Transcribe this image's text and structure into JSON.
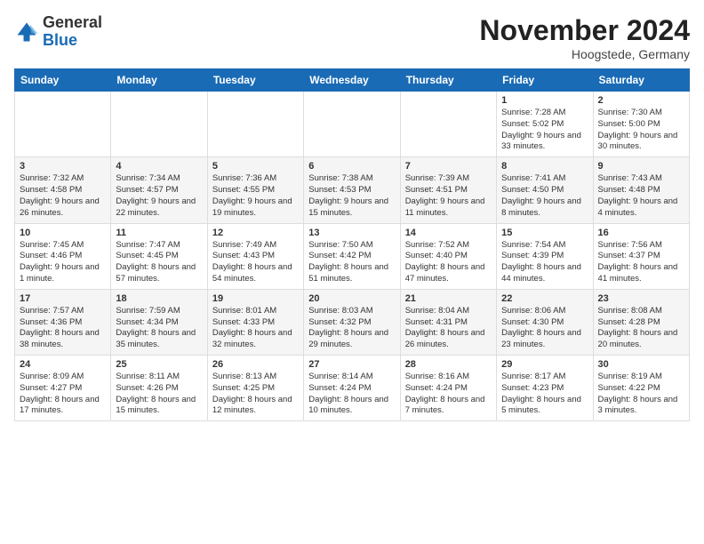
{
  "logo": {
    "general": "General",
    "blue": "Blue"
  },
  "header": {
    "month": "November 2024",
    "location": "Hoogstede, Germany"
  },
  "weekdays": [
    "Sunday",
    "Monday",
    "Tuesday",
    "Wednesday",
    "Thursday",
    "Friday",
    "Saturday"
  ],
  "weeks": [
    [
      {
        "day": "",
        "info": ""
      },
      {
        "day": "",
        "info": ""
      },
      {
        "day": "",
        "info": ""
      },
      {
        "day": "",
        "info": ""
      },
      {
        "day": "",
        "info": ""
      },
      {
        "day": "1",
        "info": "Sunrise: 7:28 AM\nSunset: 5:02 PM\nDaylight: 9 hours\nand 33 minutes."
      },
      {
        "day": "2",
        "info": "Sunrise: 7:30 AM\nSunset: 5:00 PM\nDaylight: 9 hours\nand 30 minutes."
      }
    ],
    [
      {
        "day": "3",
        "info": "Sunrise: 7:32 AM\nSunset: 4:58 PM\nDaylight: 9 hours\nand 26 minutes."
      },
      {
        "day": "4",
        "info": "Sunrise: 7:34 AM\nSunset: 4:57 PM\nDaylight: 9 hours\nand 22 minutes."
      },
      {
        "day": "5",
        "info": "Sunrise: 7:36 AM\nSunset: 4:55 PM\nDaylight: 9 hours\nand 19 minutes."
      },
      {
        "day": "6",
        "info": "Sunrise: 7:38 AM\nSunset: 4:53 PM\nDaylight: 9 hours\nand 15 minutes."
      },
      {
        "day": "7",
        "info": "Sunrise: 7:39 AM\nSunset: 4:51 PM\nDaylight: 9 hours\nand 11 minutes."
      },
      {
        "day": "8",
        "info": "Sunrise: 7:41 AM\nSunset: 4:50 PM\nDaylight: 9 hours\nand 8 minutes."
      },
      {
        "day": "9",
        "info": "Sunrise: 7:43 AM\nSunset: 4:48 PM\nDaylight: 9 hours\nand 4 minutes."
      }
    ],
    [
      {
        "day": "10",
        "info": "Sunrise: 7:45 AM\nSunset: 4:46 PM\nDaylight: 9 hours\nand 1 minute."
      },
      {
        "day": "11",
        "info": "Sunrise: 7:47 AM\nSunset: 4:45 PM\nDaylight: 8 hours\nand 57 minutes."
      },
      {
        "day": "12",
        "info": "Sunrise: 7:49 AM\nSunset: 4:43 PM\nDaylight: 8 hours\nand 54 minutes."
      },
      {
        "day": "13",
        "info": "Sunrise: 7:50 AM\nSunset: 4:42 PM\nDaylight: 8 hours\nand 51 minutes."
      },
      {
        "day": "14",
        "info": "Sunrise: 7:52 AM\nSunset: 4:40 PM\nDaylight: 8 hours\nand 47 minutes."
      },
      {
        "day": "15",
        "info": "Sunrise: 7:54 AM\nSunset: 4:39 PM\nDaylight: 8 hours\nand 44 minutes."
      },
      {
        "day": "16",
        "info": "Sunrise: 7:56 AM\nSunset: 4:37 PM\nDaylight: 8 hours\nand 41 minutes."
      }
    ],
    [
      {
        "day": "17",
        "info": "Sunrise: 7:57 AM\nSunset: 4:36 PM\nDaylight: 8 hours\nand 38 minutes."
      },
      {
        "day": "18",
        "info": "Sunrise: 7:59 AM\nSunset: 4:34 PM\nDaylight: 8 hours\nand 35 minutes."
      },
      {
        "day": "19",
        "info": "Sunrise: 8:01 AM\nSunset: 4:33 PM\nDaylight: 8 hours\nand 32 minutes."
      },
      {
        "day": "20",
        "info": "Sunrise: 8:03 AM\nSunset: 4:32 PM\nDaylight: 8 hours\nand 29 minutes."
      },
      {
        "day": "21",
        "info": "Sunrise: 8:04 AM\nSunset: 4:31 PM\nDaylight: 8 hours\nand 26 minutes."
      },
      {
        "day": "22",
        "info": "Sunrise: 8:06 AM\nSunset: 4:30 PM\nDaylight: 8 hours\nand 23 minutes."
      },
      {
        "day": "23",
        "info": "Sunrise: 8:08 AM\nSunset: 4:28 PM\nDaylight: 8 hours\nand 20 minutes."
      }
    ],
    [
      {
        "day": "24",
        "info": "Sunrise: 8:09 AM\nSunset: 4:27 PM\nDaylight: 8 hours\nand 17 minutes."
      },
      {
        "day": "25",
        "info": "Sunrise: 8:11 AM\nSunset: 4:26 PM\nDaylight: 8 hours\nand 15 minutes."
      },
      {
        "day": "26",
        "info": "Sunrise: 8:13 AM\nSunset: 4:25 PM\nDaylight: 8 hours\nand 12 minutes."
      },
      {
        "day": "27",
        "info": "Sunrise: 8:14 AM\nSunset: 4:24 PM\nDaylight: 8 hours\nand 10 minutes."
      },
      {
        "day": "28",
        "info": "Sunrise: 8:16 AM\nSunset: 4:24 PM\nDaylight: 8 hours\nand 7 minutes."
      },
      {
        "day": "29",
        "info": "Sunrise: 8:17 AM\nSunset: 4:23 PM\nDaylight: 8 hours\nand 5 minutes."
      },
      {
        "day": "30",
        "info": "Sunrise: 8:19 AM\nSunset: 4:22 PM\nDaylight: 8 hours\nand 3 minutes."
      }
    ]
  ]
}
